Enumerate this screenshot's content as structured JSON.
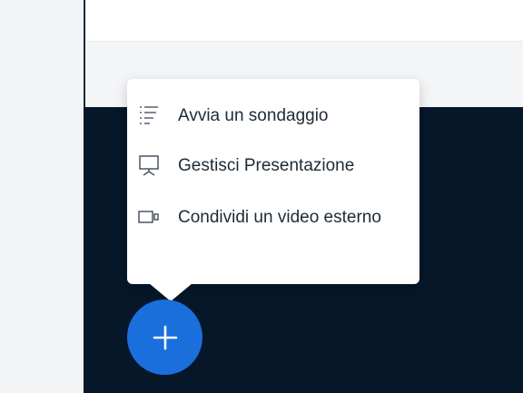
{
  "menu": {
    "items": [
      {
        "label": "Avvia un sondaggio",
        "icon": "poll-list-icon"
      },
      {
        "label": "Gestisci Presentazione",
        "icon": "presentation-icon"
      },
      {
        "label": "Condividi un video esterno",
        "icon": "video-camera-icon"
      }
    ]
  },
  "actions_button": {
    "icon": "plus-icon",
    "color": "#1a6fdc"
  },
  "colors": {
    "dark_background": "#06172a",
    "menu_text": "#1e2a38"
  }
}
